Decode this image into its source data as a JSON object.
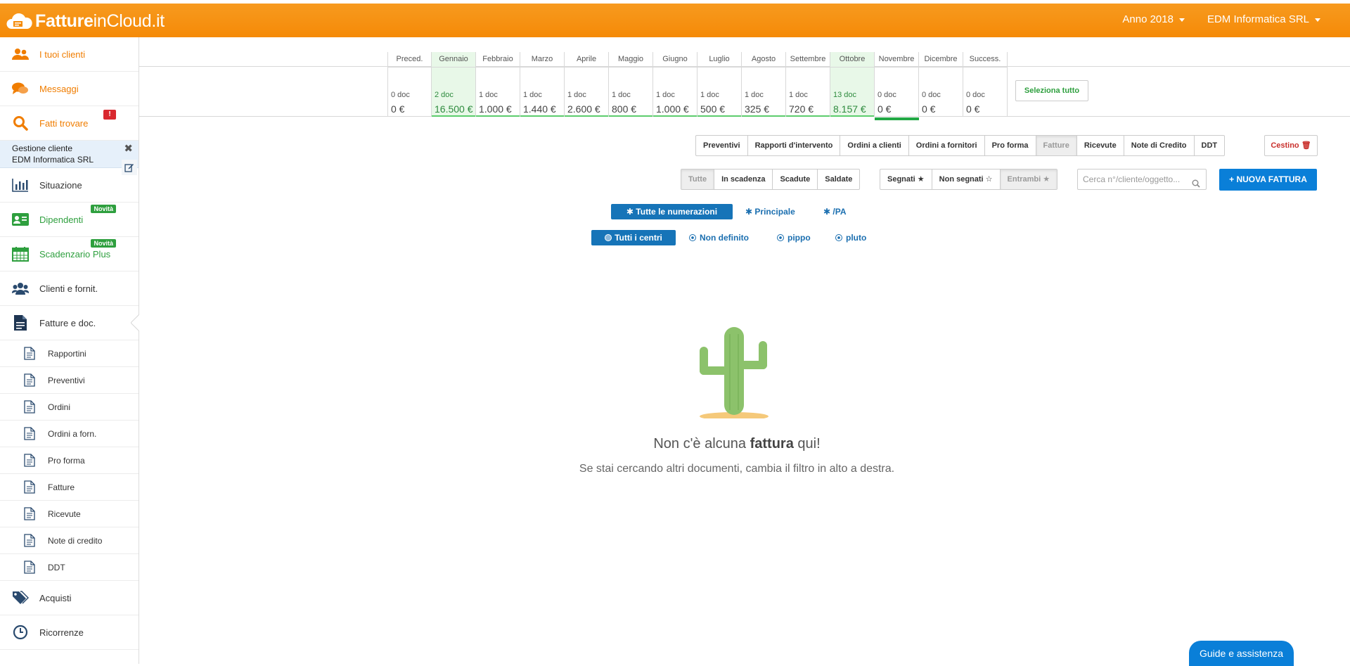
{
  "brand": {
    "bold": "Fatture",
    "light": "inCloud.it"
  },
  "topbar": {
    "year": "Anno 2018",
    "company": "EDM Informatica SRL"
  },
  "sidebar": {
    "clients": "I tuoi clienti",
    "messages": "Messaggi",
    "find": "Fatti trovare",
    "alert": "!",
    "gestione_title": "Gestione cliente",
    "gestione_company": "EDM Informatica SRL",
    "situazione": "Situazione",
    "dipendenti": "Dipendenti",
    "scadenzario": "Scadenzario Plus",
    "novita": "Novità",
    "clienti_fornit": "Clienti e fornit.",
    "fatture_doc": "Fatture e doc.",
    "subitems": [
      "Rapportini",
      "Preventivi",
      "Ordini",
      "Ordini a forn.",
      "Pro forma",
      "Fatture",
      "Ricevute",
      "Note di credito",
      "DDT"
    ],
    "acquisti": "Acquisti",
    "ricorrenze": "Ricorrenze"
  },
  "months": [
    {
      "name": "Preced.",
      "docs": "0 doc",
      "value": "0 €"
    },
    {
      "name": "Gennaio",
      "docs": "2 doc",
      "value": "16.500 €"
    },
    {
      "name": "Febbraio",
      "docs": "1 doc",
      "value": "1.000 €"
    },
    {
      "name": "Marzo",
      "docs": "1 doc",
      "value": "1.440 €"
    },
    {
      "name": "Aprile",
      "docs": "1 doc",
      "value": "2.600 €"
    },
    {
      "name": "Maggio",
      "docs": "1 doc",
      "value": "800 €"
    },
    {
      "name": "Giugno",
      "docs": "1 doc",
      "value": "1.000 €"
    },
    {
      "name": "Luglio",
      "docs": "1 doc",
      "value": "500 €"
    },
    {
      "name": "Agosto",
      "docs": "1 doc",
      "value": "325 €"
    },
    {
      "name": "Settembre",
      "docs": "1 doc",
      "value": "720 €"
    },
    {
      "name": "Ottobre",
      "docs": "13 doc",
      "value": "8.157 €"
    },
    {
      "name": "Novembre",
      "docs": "0 doc",
      "value": "0 €"
    },
    {
      "name": "Dicembre",
      "docs": "0 doc",
      "value": "0 €"
    },
    {
      "name": "Success.",
      "docs": "0 doc",
      "value": "0 €"
    }
  ],
  "select_all": "Seleziona tutto",
  "doc_types": [
    "Preventivi",
    "Rapporti d'intervento",
    "Ordini a clienti",
    "Ordini a fornitori",
    "Pro forma",
    "Fatture",
    "Ricevute",
    "Note di Credito",
    "DDT"
  ],
  "cestino": "Cestino",
  "status_filter": [
    "Tutte",
    "In scadenza",
    "Scadute",
    "Saldate"
  ],
  "mark_filter": [
    "Segnati ★",
    "Non segnati ☆",
    "Entrambi ★"
  ],
  "search": {
    "placeholder": "Cerca n°/cliente/oggetto..."
  },
  "new_invoice": "+ NUOVA FATTURA",
  "numbering": [
    "✱ Tutte le numerazioni",
    "✱ Principale",
    "✱ /PA"
  ],
  "centers": [
    "Tutti i centri",
    "Non definito",
    "pippo",
    "pluto"
  ],
  "empty": {
    "pre": "Non c'è alcuna ",
    "bold": "fattura",
    "post": " qui!",
    "sub": "Se stai cercando altri documenti, cambia il filtro in alto a destra."
  },
  "guide": "Guide e assistenza",
  "colors": {
    "accent": "#f58a07",
    "primary": "#0a7fd8",
    "success": "#2e9f3e"
  }
}
